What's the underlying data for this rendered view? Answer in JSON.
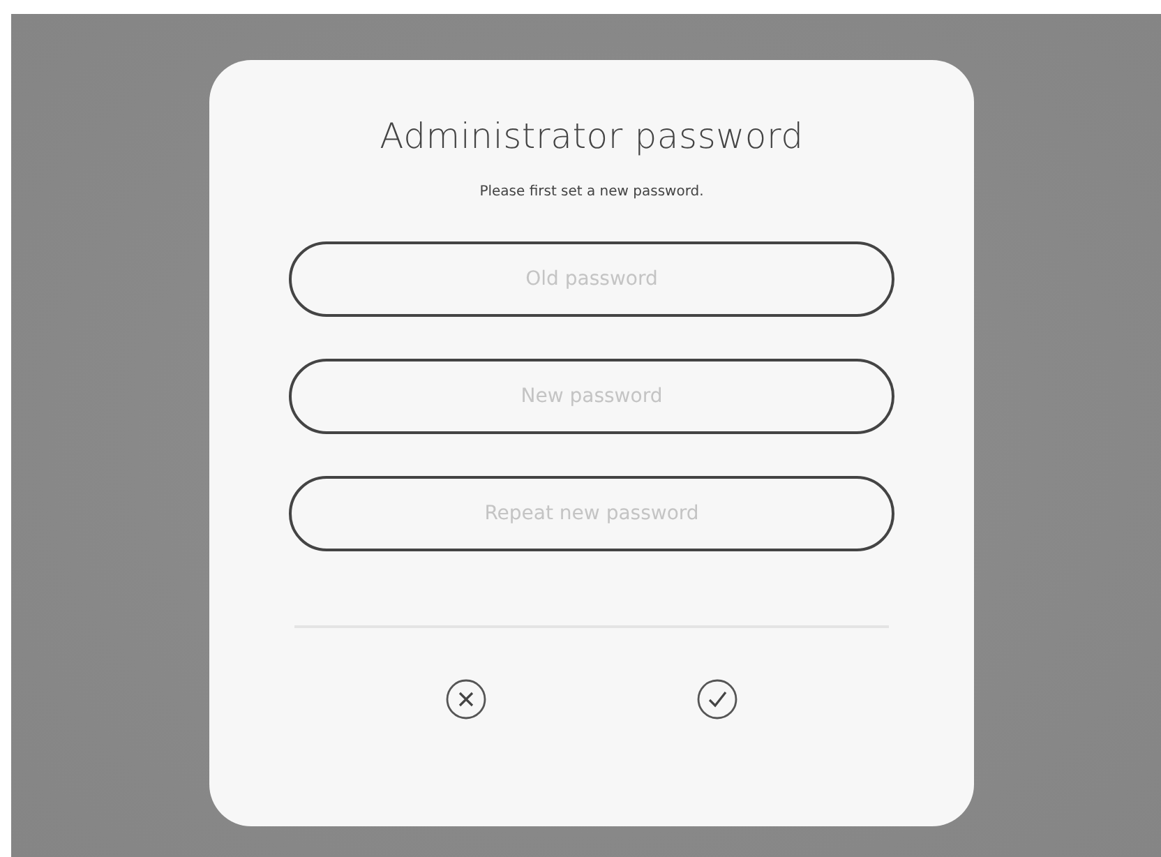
{
  "dialog": {
    "title": "Administrator password",
    "message": "Please first set a new password.",
    "fields": [
      {
        "placeholder": "Old password"
      },
      {
        "placeholder": "New password"
      },
      {
        "placeholder": "Repeat new password"
      }
    ],
    "actions": [
      {
        "kind": "cancel"
      },
      {
        "kind": "confirm"
      }
    ]
  }
}
